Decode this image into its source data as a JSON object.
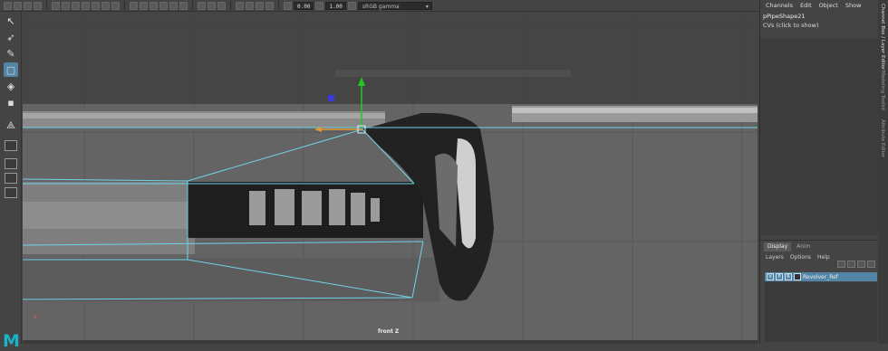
{
  "toolbar": {
    "field_one": "0.00",
    "field_two": "1.00",
    "color_space": "sRGB gamma"
  },
  "toolbox": {
    "tools": [
      "select-tool",
      "lasso-tool",
      "paint-select-tool",
      "move-tool",
      "rotate-tool",
      "scale-tool"
    ],
    "logo_text": "M"
  },
  "viewport": {
    "camera_label": "front Z",
    "axis_label": "z"
  },
  "channel_box": {
    "menu": [
      "Channels",
      "Edit",
      "Object",
      "Show"
    ],
    "object_name": "pPipeShape21",
    "cvs_text": "CVs (click to show)"
  },
  "layer_editor": {
    "tabs": [
      "Display",
      "Anim"
    ],
    "menu": [
      "Layers",
      "Options",
      "Help"
    ],
    "layer": {
      "v": "V",
      "p": "P",
      "r": "R",
      "name": "Revolver_Ref"
    }
  },
  "side_tabs": [
    "Channel Box / Layer Editor",
    "Modeling Toolkit",
    "Attribute Editor"
  ],
  "colors": {
    "accent": "#5285a6",
    "wire": "#6fd3e8",
    "manip_y": "#21c821",
    "manip_x": "#e59b2c",
    "manip_center": "#3a3adb",
    "logo": "#19b3c7"
  }
}
